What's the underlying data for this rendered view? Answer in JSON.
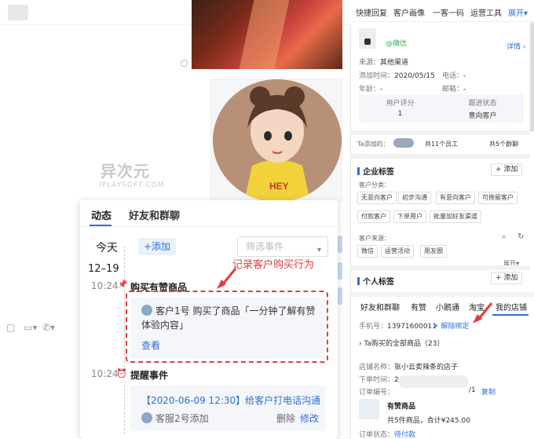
{
  "chat": {
    "watermark_main": "异次元",
    "watermark_sub": "IPLAYSOFT.COM"
  },
  "popup": {
    "tabs": [
      "动态",
      "好友和群聊"
    ],
    "today": "今天",
    "add_label": "+添加",
    "filter_placeholder": "筛选事件",
    "date": "12–19",
    "events": [
      {
        "time": "10:24",
        "title": "购买有赞商品",
        "who": "客户1号",
        "content": "购买了商品「一分钟了解有赞体验内容」",
        "action": "查看"
      },
      {
        "time": "10:24",
        "title": "提醒事件",
        "content": "【2020-06-09 12:30】给客户打电话沟通",
        "by": "客服2号添加",
        "delete": "删除",
        "edit": "修改"
      }
    ]
  },
  "annotation": "记录客户购买行为",
  "right": {
    "top_links": [
      "快捷回复",
      "客户画像",
      "一客一码",
      "运营工具",
      "展开"
    ],
    "wechat_tag": "@微信",
    "detail": "详情",
    "fields": [
      {
        "k": "来源：",
        "v": "其他渠道"
      },
      {
        "k": "添加时间：",
        "v": "2020/05/15"
      },
      {
        "k": "电话：",
        "v": "-"
      },
      {
        "k": "年龄：",
        "v": "-"
      },
      {
        "k": "邮箱：",
        "v": "-"
      }
    ],
    "stats": {
      "score_label": "用户评分",
      "score": "1",
      "follow_label": "跟进状态",
      "follow": "意向客户"
    },
    "ta_added": "Ta添加的：",
    "ta_staff": "共11个员工",
    "ta_groups": "共5个群聊",
    "corp_tags": "企业标签",
    "add": "+ 添加",
    "cust_class": "客户分类：",
    "class_chips": [
      "无意向客户",
      "初步沟通",
      "有意向客户",
      "可挽留客户",
      "付款客户",
      "下单用户",
      "批量加好友渠道"
    ],
    "cust_source": "客户来源：",
    "source_chips": [
      "微信",
      "运营活动",
      "朋友圈"
    ],
    "expand": "展开",
    "personal_tags": "个人标签",
    "tabs": [
      "好友和群聊",
      "有赞",
      "小鹅通",
      "淘宝",
      "我的店铺"
    ],
    "phone_label": "手机号：",
    "phone": "13971600011",
    "unbind": "解除绑定",
    "ta_bought": "Ta购买的全部商品（23）",
    "shop_label": "店铺名称：",
    "shop": "张小云卖辣条的店子",
    "order_time_label": "下单时间：",
    "order_time": "2",
    "order_no_label": "订单编号：",
    "order_no_tail": "/1",
    "copy": "复制",
    "goods_title": "有赞商品",
    "goods_summary": "共5件商品，合计¥245.00",
    "order_status": "订单状态：",
    "order_status_val": "待付款"
  },
  "colors": {
    "accent": "#2f6fd6",
    "annotation": "#e03c3c",
    "wechat": "#2bb24c"
  }
}
